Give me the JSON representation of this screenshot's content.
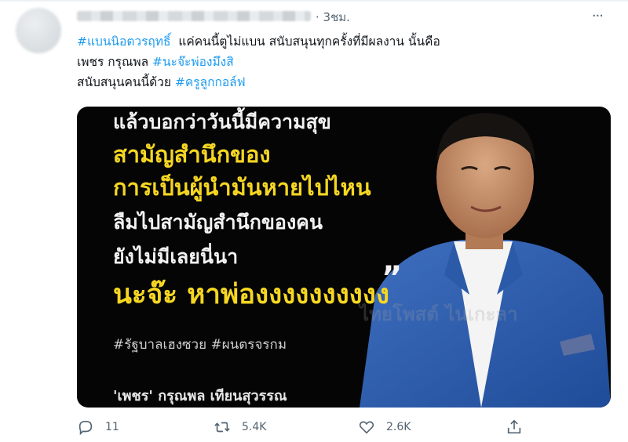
{
  "tweet": {
    "time": "· 3ชม.",
    "lines": [
      [
        {
          "text": "#แบนนิอตวรฤทธิ์",
          "hashtag": true
        },
        {
          "text": "  แค่คนนี้ตูไม่แบน สนับสนุนทุกครั้งที่มีผลงาน นั้นคือ",
          "hashtag": false
        }
      ],
      [
        {
          "text": "เพชร กรุณพล ",
          "hashtag": false
        },
        {
          "text": "#นะจ๊ะพ่องมึงสิ",
          "hashtag": true
        }
      ],
      [
        {
          "text": "สนับสนุนคนนี้ด้วย ",
          "hashtag": false
        },
        {
          "text": "#ครูลูกกอล์ฟ",
          "hashtag": true
        }
      ]
    ]
  },
  "image": {
    "line1": "แล้วบอกว่าวันนี้มีความสุข",
    "line2": "สามัญสำนึกของ",
    "line3": "การเป็นผู้นำมันหายไปไหน",
    "line4": "ลืมไปสามัญสำนึกของคน",
    "line5": "ยังไม่มีเลยนี่นา",
    "line6": "นะจ๊ะ หาพ่องงงงงงงงงง",
    "quote": "”",
    "hashtags": "#รัฐบาลเฮงซวย #ผนตรจรกม",
    "credit": "'เพชร' กรุณพล เทียนสุวรรณ",
    "watermark": "ไทยโพสต์ ไนเกะลา"
  },
  "actions": {
    "reply_count": "11",
    "retweet_count": "5.4K",
    "like_count": "2.6K"
  },
  "icons": {
    "more": "more-icon",
    "reply": "reply-icon",
    "retweet": "retweet-icon",
    "like": "like-icon",
    "share": "share-icon"
  },
  "colors": {
    "hashtag": "#1d9bf0",
    "image_yellow": "#f5d622",
    "secondary_text": "#536471"
  }
}
